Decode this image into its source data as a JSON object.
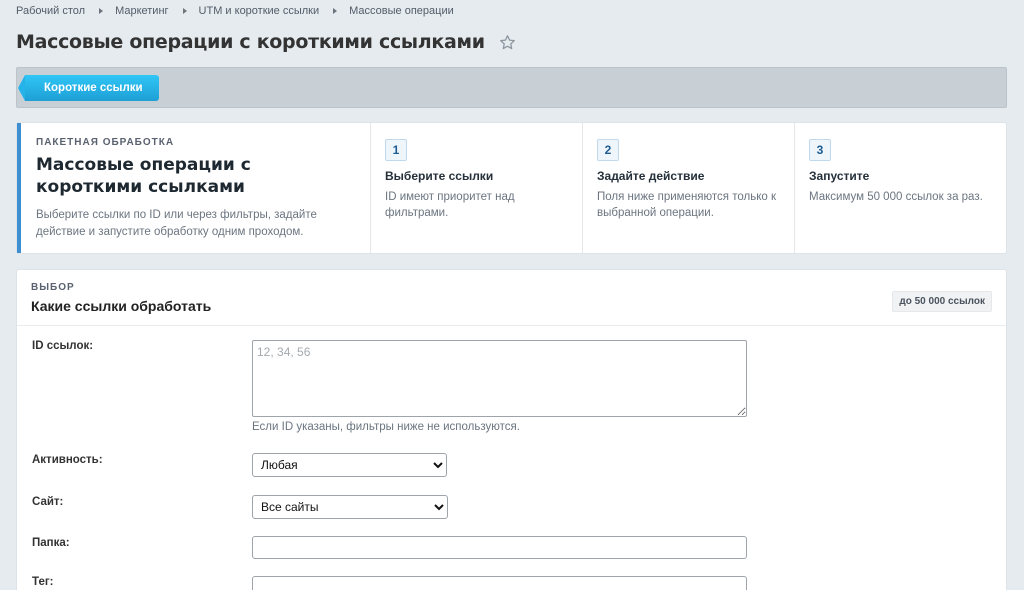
{
  "breadcrumb": [
    "Рабочий стол",
    "Маркетинг",
    "UTM и короткие ссылки",
    "Массовые операции"
  ],
  "page": {
    "title": "Массовые операции с короткими ссылками"
  },
  "toolbar": {
    "short_links_label": "Короткие ссылки"
  },
  "intro": {
    "eyebrow": "ПАКЕТНАЯ ОБРАБОТКА",
    "title": "Массовые операции с короткими ссылками",
    "description": "Выберите ссылки по ID или через фильтры, задайте действие и запустите обработку одним проходом."
  },
  "steps": [
    {
      "num": "1",
      "title": "Выберите ссылки",
      "desc": "ID имеют приоритет над фильтрами."
    },
    {
      "num": "2",
      "title": "Задайте действие",
      "desc": "Поля ниже применяются только к выбранной операции."
    },
    {
      "num": "3",
      "title": "Запустите",
      "desc": "Максимум 50 000 ссылок за раз."
    }
  ],
  "selection": {
    "eyebrow": "ВЫБОР",
    "title": "Какие ссылки обработать",
    "limit_badge": "до 50 000 ссылок",
    "ids_label": "ID ссылок:",
    "ids_placeholder": "12, 34, 56",
    "ids_hint": "Если ID указаны, фильтры ниже не используются.",
    "activity_label": "Активность:",
    "activity_value": "Любая",
    "site_label": "Сайт:",
    "site_value": "Все сайты",
    "folder_label": "Папка:",
    "tag_label": "Тег:"
  },
  "colors": {
    "accent_blue": "#2fc6f6",
    "intro_border": "#3d8fd1",
    "background": "#e5ebee"
  },
  "icons": {
    "favorite": "star-icon"
  }
}
